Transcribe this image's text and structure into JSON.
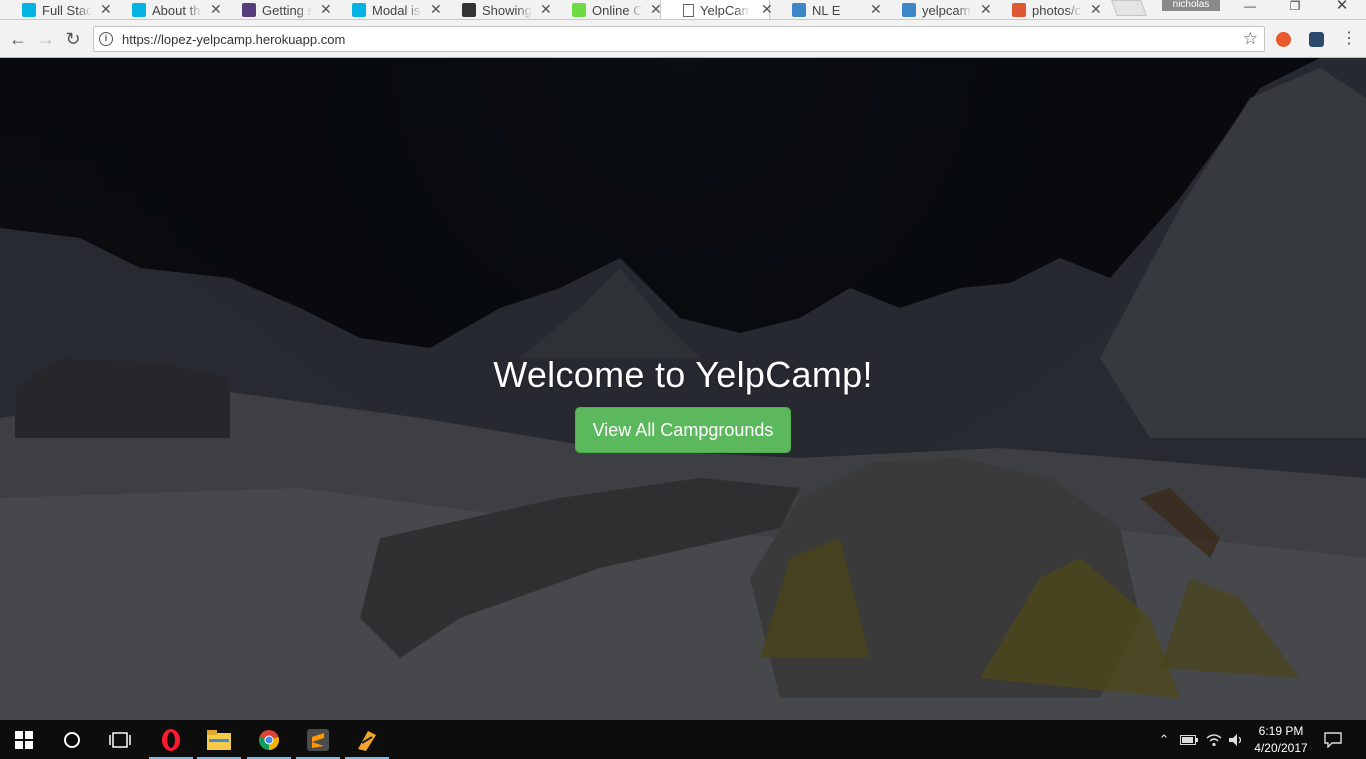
{
  "browser": {
    "tabs": [
      {
        "title": "Full Stack",
        "favicon": "udacity-icon",
        "color": "#02b3e4"
      },
      {
        "title": "About the",
        "favicon": "udacity-icon",
        "color": "#02b3e4"
      },
      {
        "title": "Getting s",
        "favicon": "bootstrap-icon",
        "color": "#563d7c"
      },
      {
        "title": "Modal is",
        "favicon": "udacity-icon",
        "color": "#02b3e4"
      },
      {
        "title": "Showing",
        "favicon": "github-icon",
        "color": "#333333"
      },
      {
        "title": "Online C",
        "favicon": "upwork-icon",
        "color": "#6fda44"
      },
      {
        "title": "YelpCam",
        "favicon": "page-icon",
        "color": "#ffffff",
        "active": true
      },
      {
        "title": "NL E",
        "favicon": "cloud-icon",
        "color": "#3d87c8"
      },
      {
        "title": "yelpcam",
        "favicon": "cloud-icon",
        "color": "#3d87c8"
      },
      {
        "title": "photos/c",
        "favicon": "duckduckgo-icon",
        "color": "#de5833"
      }
    ],
    "profile_name": "nicholas",
    "url": "https://lopez-yelpcamp.herokuapp.com"
  },
  "page": {
    "heading": "Welcome to YelpCamp!",
    "cta_label": "View All Campgrounds",
    "cta_color": "#5cb85c"
  },
  "taskbar": {
    "apps": [
      "windows-start-icon",
      "cortana-search-icon",
      "task-view-icon",
      "opera-icon",
      "file-explorer-icon",
      "chrome-icon",
      "sublime-text-icon",
      "winamp-icon"
    ],
    "time": "6:19 PM",
    "date": "4/20/2017"
  }
}
